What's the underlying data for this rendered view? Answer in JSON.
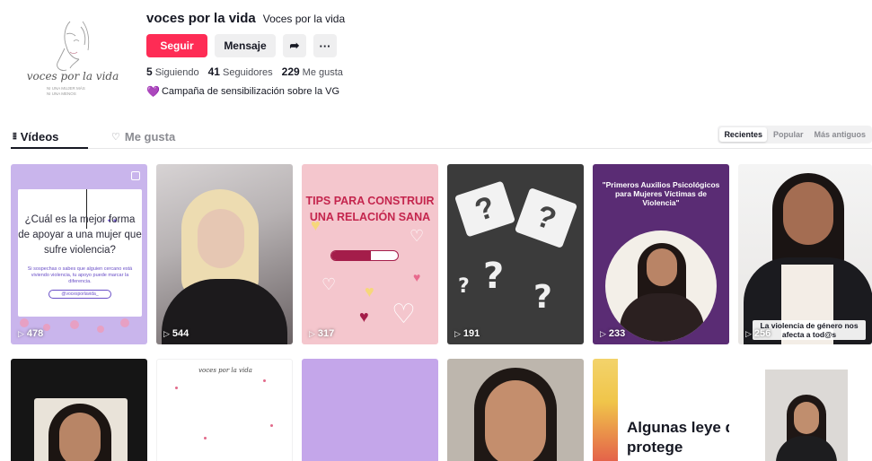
{
  "profile": {
    "username": "voces por la vida",
    "nickname": "Voces por la vida",
    "avatar_text": "voces por la vida",
    "avatar_subtext": "NI UNA MUJER MÁS\nNI UNA MENOS",
    "follow_label": "Seguir",
    "message_label": "Mensaje",
    "share_icon": "share-icon",
    "more_icon": "more-icon",
    "more_label": "···",
    "share_label": "➦",
    "stats": {
      "following_count": "5",
      "following_label": "Siguiendo",
      "followers_count": "41",
      "followers_label": "Seguidores",
      "likes_count": "229",
      "likes_label": "Me gusta"
    },
    "bio": "Campaña de sensibilización sobre la VG",
    "bio_icon": "💜"
  },
  "tabs": {
    "videos_label": "Vídeos",
    "likes_label": "Me gusta"
  },
  "sort": {
    "options": [
      "Recientes",
      "Popular",
      "Más antiguos"
    ],
    "active": "Recientes"
  },
  "videos_row1": [
    {
      "views": "478",
      "question": "¿Cuál es la mejor forma de apoyar a una mujer que sufre violencia?",
      "small_text": "Si sospechas o sabes que alguien cercano está viviendo violencia, tu apoyo puede marcar la diferencia.",
      "pill_text": "@vocesporlavida_"
    },
    {
      "views": "544"
    },
    {
      "views": "317",
      "title": "TIPS PARA CONSTRUIR UNA RELACIÓN SANA",
      "progress": 0.6
    },
    {
      "views": "191"
    },
    {
      "views": "233",
      "title": "\"Primeros Auxilios Psicológicos para Mujeres Víctimas de Violencia\""
    },
    {
      "views": "256",
      "caption": "La violencia de género nos afecta a tod@s"
    }
  ],
  "videos_row2": [
    {},
    {
      "script": "voces por la vida"
    },
    {},
    {},
    {
      "title": "Algunas leye que protege"
    },
    {}
  ],
  "colors": {
    "brand": "#fe2c55",
    "text": "#161823",
    "muted": "#8a8b91"
  }
}
